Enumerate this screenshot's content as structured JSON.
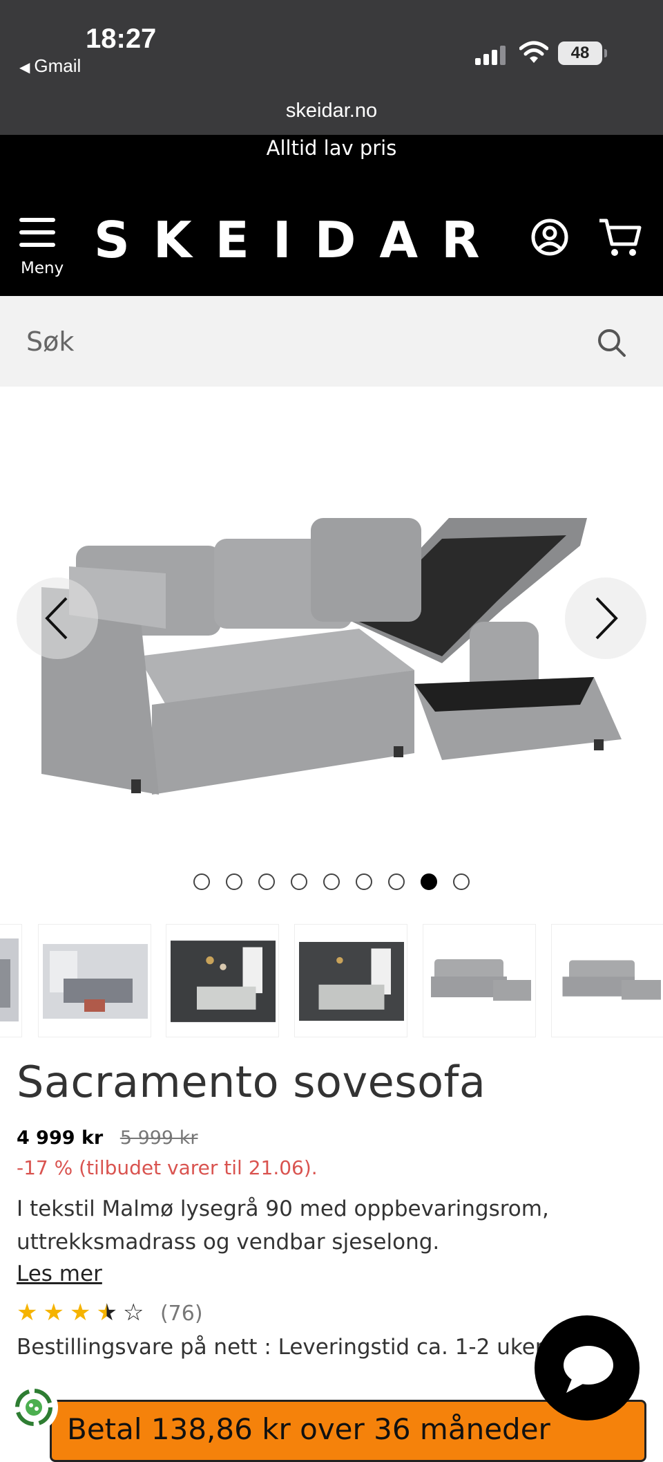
{
  "status_bar": {
    "time": "18:27",
    "back_app": "Gmail",
    "battery": "48"
  },
  "browser": {
    "url": "skeidar.no"
  },
  "promo": {
    "text": "Alltid lav pris"
  },
  "header": {
    "logo": "SKEIDAR",
    "menu_label": "Meny"
  },
  "search": {
    "placeholder": "Søk"
  },
  "gallery": {
    "dot_count": 9,
    "active_dot": 8
  },
  "product": {
    "title": "Sacramento sovesofa",
    "price": "4 999 kr",
    "old_price": "5 999 kr",
    "discount": "-17 % (tilbudet varer til 21.06).",
    "description": "I tekstil Malmø lysegrå 90 med oppbevaringsrom, uttrekksmadrass og vendbar sjeselong.",
    "read_more": "Les mer",
    "rating": 3.5,
    "rating_max": 5,
    "review_count": "(76)",
    "delivery": "Bestillingsvare på nett : Leveringstid ca. 1-2 uker"
  },
  "finance": {
    "text": "Betal 138,86 kr over 36 måneder"
  },
  "colors": {
    "accent_orange": "#f5820b",
    "discount_red": "#d9534f",
    "star_gold": "#f5b301",
    "header_black": "#000000"
  }
}
